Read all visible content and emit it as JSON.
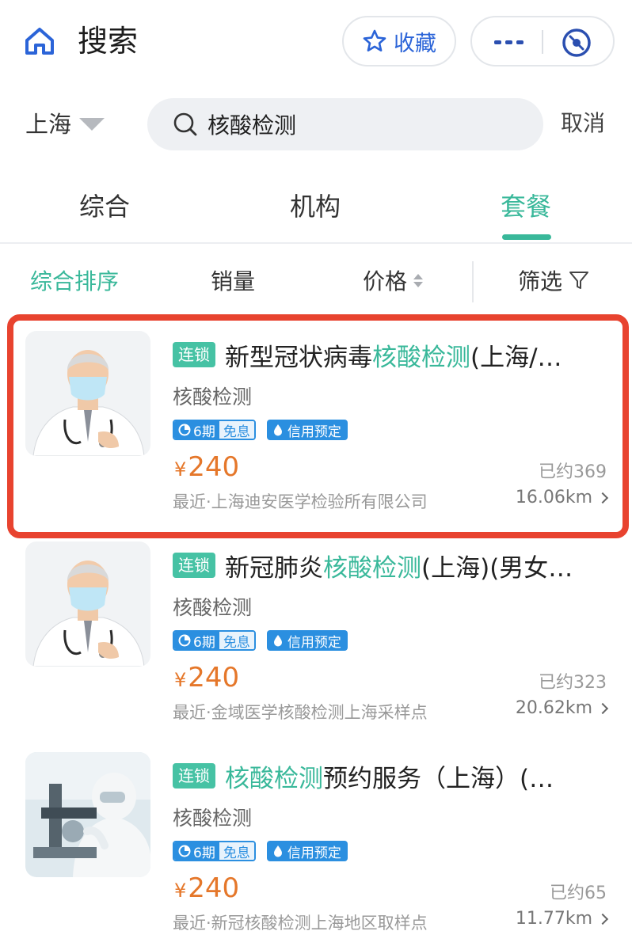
{
  "header": {
    "title": "搜索",
    "favorite_label": "收藏",
    "icons": {
      "home": "home-icon",
      "favorite": "star-icon",
      "more": "more-icon",
      "close": "close-miniprogram-icon"
    }
  },
  "search": {
    "city": "上海",
    "query": "核酸检测",
    "cancel_label": "取消"
  },
  "tabs": [
    {
      "label": "综合",
      "active": false
    },
    {
      "label": "机构",
      "active": false
    },
    {
      "label": "套餐",
      "active": true
    }
  ],
  "sort": [
    {
      "label": "综合排序",
      "active": true
    },
    {
      "label": "销量",
      "active": false
    },
    {
      "label": "价格",
      "active": false
    },
    {
      "label": "筛选",
      "active": false
    }
  ],
  "colors": {
    "accent": "#39b89a",
    "price": "#e5772a",
    "badge_blue": "#2b8fe0",
    "highlight_box": "#e8432f"
  },
  "results": [
    {
      "tag": "连锁",
      "title_pre": "新型冠状病毒",
      "title_hl": "核酸检测",
      "title_post": "(上海/…",
      "category": "核酸检测",
      "badge_install_num": "6期",
      "badge_install_text": "免息",
      "badge_credit": "信用预定",
      "currency": "¥",
      "price": "240",
      "booked": "已约369",
      "location": "最近·上海迪安医学检验所有限公司",
      "distance": "16.06km",
      "thumb": "doctor-portrait"
    },
    {
      "tag": "连锁",
      "title_pre": "新冠肺炎",
      "title_hl": "核酸检测",
      "title_post": "(上海)(男女…",
      "category": "核酸检测",
      "badge_install_num": "6期",
      "badge_install_text": "免息",
      "badge_credit": "信用预定",
      "currency": "¥",
      "price": "240",
      "booked": "已约323",
      "location": "最近·金域医学核酸检测上海采样点",
      "distance": "20.62km",
      "thumb": "doctor-portrait"
    },
    {
      "tag": "连锁",
      "title_pre": "",
      "title_hl": "核酸检测",
      "title_post": "预约服务（上海）(…",
      "category": "核酸检测",
      "badge_install_num": "6期",
      "badge_install_text": "免息",
      "badge_credit": "信用预定",
      "currency": "¥",
      "price": "240",
      "booked": "已约65",
      "location": "最近·新冠核酸检测上海地区取样点",
      "distance": "11.77km",
      "thumb": "lab-microscope"
    }
  ]
}
